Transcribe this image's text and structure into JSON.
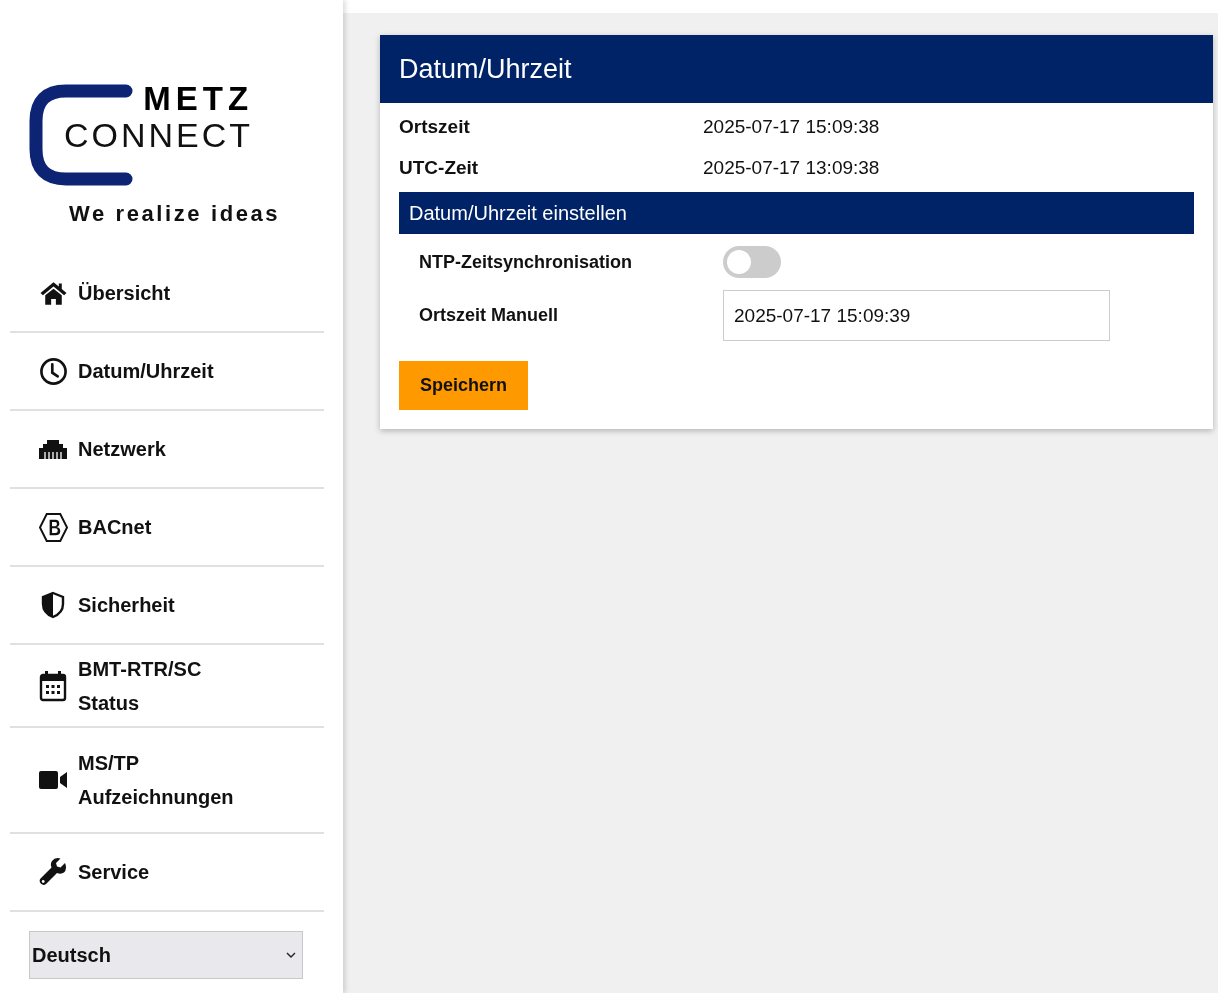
{
  "logo": {
    "brand_top": "METZ",
    "brand_bottom": "CONNECT",
    "tagline": "We realize ideas"
  },
  "nav": {
    "items": [
      {
        "label": "Übersicht",
        "kind": "home"
      },
      {
        "label": "Datum/Uhrzeit",
        "kind": "clock"
      },
      {
        "label": "Netzwerk",
        "kind": "network"
      },
      {
        "label": "BACnet",
        "kind": "bacnet"
      },
      {
        "label": "Sicherheit",
        "kind": "shield"
      },
      {
        "label": "BMT-RTR/SC Status",
        "kind": "calendar"
      },
      {
        "label": "MS/TP Aufzeichnungen",
        "kind": "camera"
      },
      {
        "label": "Service",
        "kind": "wrench"
      }
    ],
    "language": "Deutsch"
  },
  "panel": {
    "title": "Datum/Uhrzeit",
    "info": [
      {
        "label": "Ortszeit",
        "value": "2025-07-17 15:09:38"
      },
      {
        "label": "UTC-Zeit",
        "value": "2025-07-17 13:09:38"
      }
    ],
    "section_title": "Datum/Uhrzeit einstellen",
    "ntp": {
      "label": "NTP-Zeitsynchronisation",
      "on": false
    },
    "manual": {
      "label": "Ortszeit Manuell",
      "value": "2025-07-17 15:09:39"
    },
    "save_button": "Speichern"
  }
}
